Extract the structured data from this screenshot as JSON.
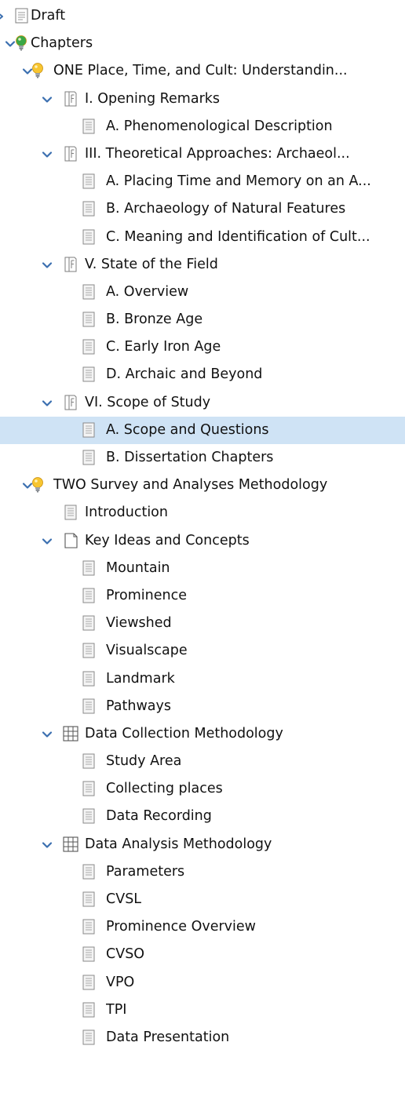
{
  "tree": [
    {
      "label": "Draft",
      "icon": "draft-icon",
      "level": 0,
      "toggle": "partial"
    },
    {
      "label": "Chapters",
      "icon": "lightbulb-green-icon",
      "level": 0,
      "toggle": "expanded"
    },
    {
      "label": "ONE Place, Time, and Cult: Understandin...",
      "icon": "lightbulb-yellow-icon",
      "level": 1,
      "toggle": "expanded"
    },
    {
      "label": "I. Opening Remarks",
      "icon": "folded-document-icon",
      "level": 2,
      "toggle": "expanded"
    },
    {
      "label": "A. Phenomenological Description",
      "icon": "text-document-icon",
      "level": 3,
      "toggle": "none"
    },
    {
      "label": "III. Theoretical Approaches: Archaeol...",
      "icon": "folded-document-icon",
      "level": 2,
      "toggle": "expanded"
    },
    {
      "label": "A. Placing Time and Memory on an A...",
      "icon": "text-document-icon",
      "level": 3,
      "toggle": "none"
    },
    {
      "label": "B. Archaeology of Natural Features",
      "icon": "text-document-icon",
      "level": 3,
      "toggle": "none"
    },
    {
      "label": "C. Meaning and Identification of Cult...",
      "icon": "text-document-icon",
      "level": 3,
      "toggle": "none"
    },
    {
      "label": "V. State of the Field",
      "icon": "folded-document-icon",
      "level": 2,
      "toggle": "expanded"
    },
    {
      "label": "A. Overview",
      "icon": "text-document-icon",
      "level": 3,
      "toggle": "none"
    },
    {
      "label": "B. Bronze Age",
      "icon": "text-document-icon",
      "level": 3,
      "toggle": "none"
    },
    {
      "label": "C. Early Iron Age",
      "icon": "text-document-icon",
      "level": 3,
      "toggle": "none"
    },
    {
      "label": "D. Archaic and Beyond",
      "icon": "text-document-icon",
      "level": 3,
      "toggle": "none"
    },
    {
      "label": "VI. Scope of Study",
      "icon": "folded-document-icon",
      "level": 2,
      "toggle": "expanded"
    },
    {
      "label": "A. Scope and Questions",
      "icon": "text-document-icon",
      "level": 3,
      "toggle": "none",
      "selected": true
    },
    {
      "label": "B. Dissertation Chapters",
      "icon": "text-document-icon",
      "level": 3,
      "toggle": "none"
    },
    {
      "label": "TWO Survey and Analyses Methodology",
      "icon": "lightbulb-yellow-icon",
      "level": 1,
      "toggle": "expanded"
    },
    {
      "label": "Introduction",
      "icon": "text-document-icon",
      "level": 2,
      "toggle": "none"
    },
    {
      "label": "Key Ideas and Concepts",
      "icon": "blank-document-icon",
      "level": 2,
      "toggle": "expanded"
    },
    {
      "label": "Mountain",
      "icon": "text-document-icon",
      "level": 3,
      "toggle": "none"
    },
    {
      "label": "Prominence",
      "icon": "text-document-icon",
      "level": 3,
      "toggle": "none"
    },
    {
      "label": "Viewshed",
      "icon": "text-document-icon",
      "level": 3,
      "toggle": "none"
    },
    {
      "label": "Visualscape",
      "icon": "text-document-icon",
      "level": 3,
      "toggle": "none"
    },
    {
      "label": "Landmark",
      "icon": "text-document-icon",
      "level": 3,
      "toggle": "none"
    },
    {
      "label": "Pathways",
      "icon": "text-document-icon",
      "level": 3,
      "toggle": "none"
    },
    {
      "label": "Data Collection Methodology",
      "icon": "grid-icon",
      "level": 2,
      "toggle": "expanded"
    },
    {
      "label": "Study Area",
      "icon": "text-document-icon",
      "level": 3,
      "toggle": "none"
    },
    {
      "label": "Collecting places",
      "icon": "text-document-icon",
      "level": 3,
      "toggle": "none"
    },
    {
      "label": "Data Recording",
      "icon": "text-document-icon",
      "level": 3,
      "toggle": "none"
    },
    {
      "label": "Data Analysis Methodology",
      "icon": "grid-icon",
      "level": 2,
      "toggle": "expanded"
    },
    {
      "label": "Parameters",
      "icon": "text-document-icon",
      "level": 3,
      "toggle": "none"
    },
    {
      "label": "CVSL",
      "icon": "text-document-icon",
      "level": 3,
      "toggle": "none"
    },
    {
      "label": "Prominence Overview",
      "icon": "text-document-icon",
      "level": 3,
      "toggle": "none"
    },
    {
      "label": "CVSO",
      "icon": "text-document-icon",
      "level": 3,
      "toggle": "none"
    },
    {
      "label": "VPO",
      "icon": "text-document-icon",
      "level": 3,
      "toggle": "none"
    },
    {
      "label": "TPI",
      "icon": "text-document-icon",
      "level": 3,
      "toggle": "none"
    },
    {
      "label": "Data Presentation",
      "icon": "text-document-icon",
      "level": 3,
      "toggle": "none"
    }
  ],
  "colors": {
    "selection": "#cfe3f5",
    "chevron": "#3b6fb0",
    "bulb_yellow": "#f7c530",
    "bulb_green": "#3aa847",
    "doc_gray": "#8a8a8a"
  }
}
